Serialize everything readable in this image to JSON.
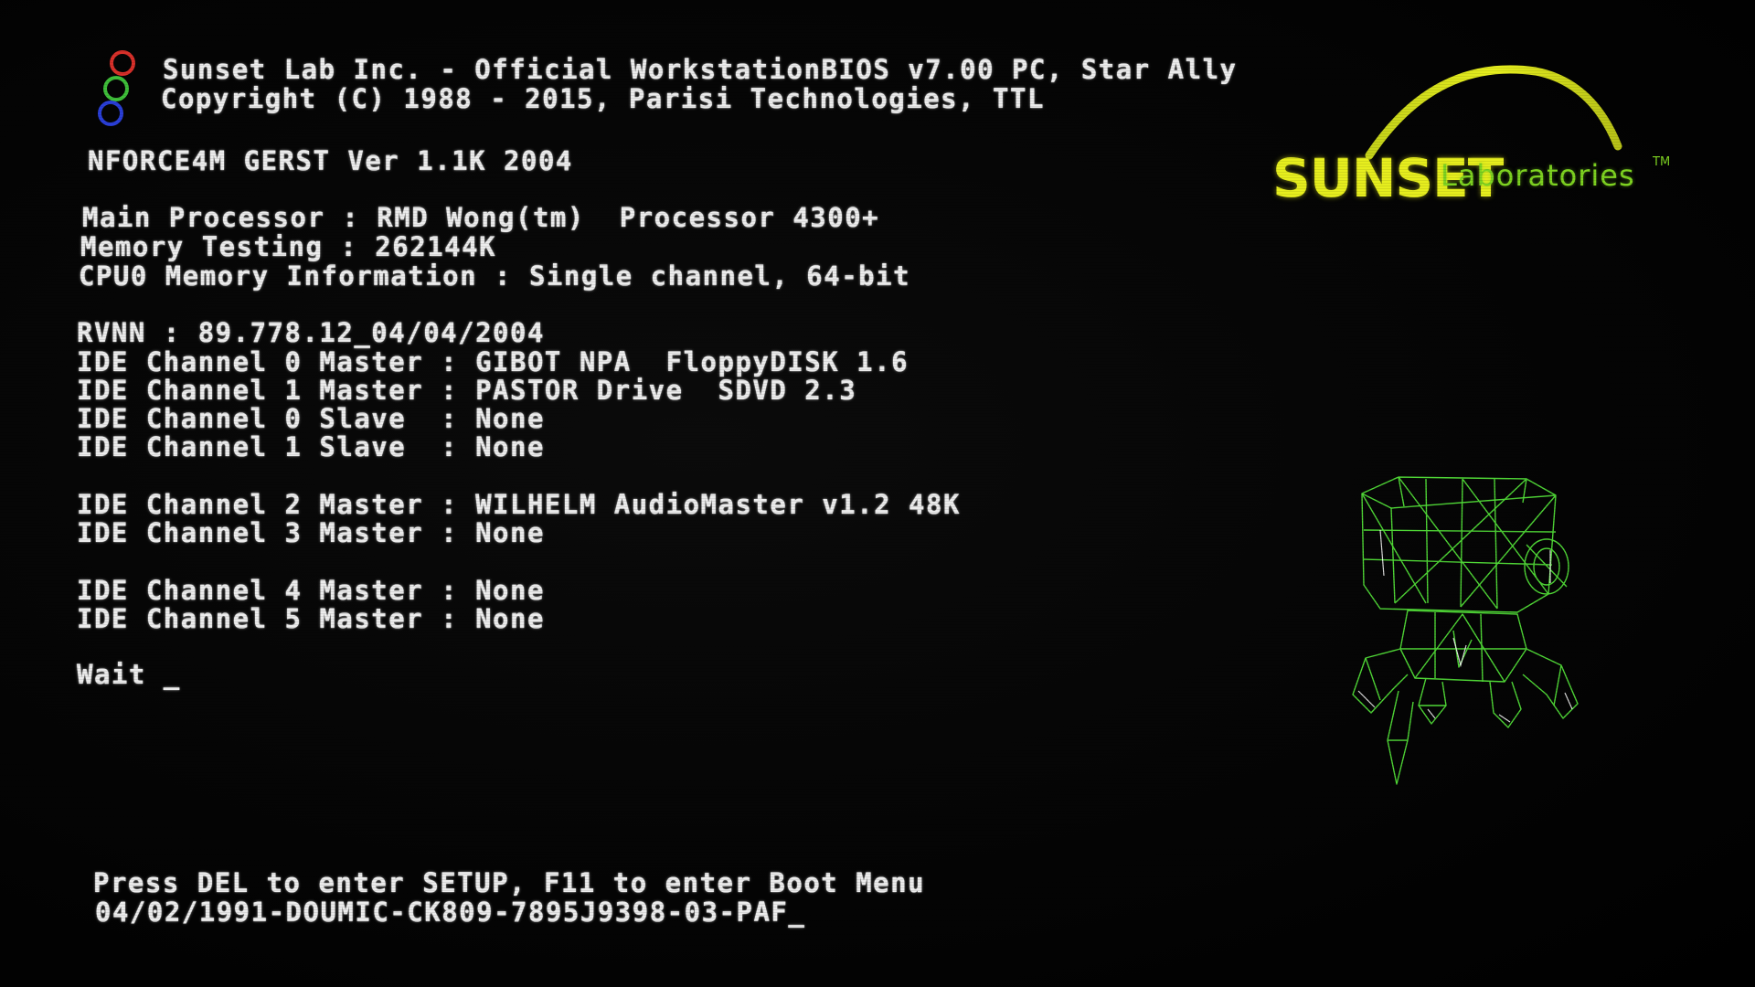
{
  "header": {
    "bios_line1": "Sunset Lab Inc. - Official WorkstationBIOS v7.00 PC, Star Ally",
    "bios_line2": "Copyright (C) 1988 - 2015, Parisi Technologies, TTL"
  },
  "board": "NFORCE4M GERST Ver 1.1K 2004",
  "system": {
    "processor": "Main Processor : RMD Wong(tm)  Processor 4300+",
    "memory": "Memory Testing : 262144K",
    "cpu_memory": "CPU0 Memory Information : Single channel, 64-bit"
  },
  "rvnn": "RVNN : 89.778.12_04/04/2004",
  "ide_group1": [
    "IDE Channel 0 Master : GIBOT NPA  FloppyDISK 1.6",
    "IDE Channel 1 Master : PASTOR Drive  SDVD 2.3",
    "IDE Channel 0 Slave  : None",
    "IDE Channel 1 Slave  : None"
  ],
  "ide_group2": [
    "IDE Channel 2 Master : WILHELM AudioMaster v1.2 48K",
    "IDE Channel 3 Master : None"
  ],
  "ide_group3": [
    "IDE Channel 4 Master : None",
    "IDE Channel 5 Master : None"
  ],
  "status": "Wait _",
  "footer": {
    "hint": "Press DEL to enter SETUP, F11 to enter Boot Menu",
    "build": "04/02/1991-DOUMIC-CK809-7895J9398-03-PAF_"
  },
  "brand": {
    "word1": "SUNSET",
    "word2": "Laboratories",
    "tm": "TM",
    "color_primary": "#e6ee1e",
    "color_secondary": "#7ed321"
  },
  "icons": {
    "rings": "rgb-rings-logo-icon",
    "robot": "wireframe-robot-icon"
  },
  "colors": {
    "text": "#ececec",
    "background": "#020202",
    "ring_red": "#d8302a",
    "ring_green": "#3fbf3a",
    "ring_blue": "#2a3fd8",
    "robot": "#4fd636"
  }
}
